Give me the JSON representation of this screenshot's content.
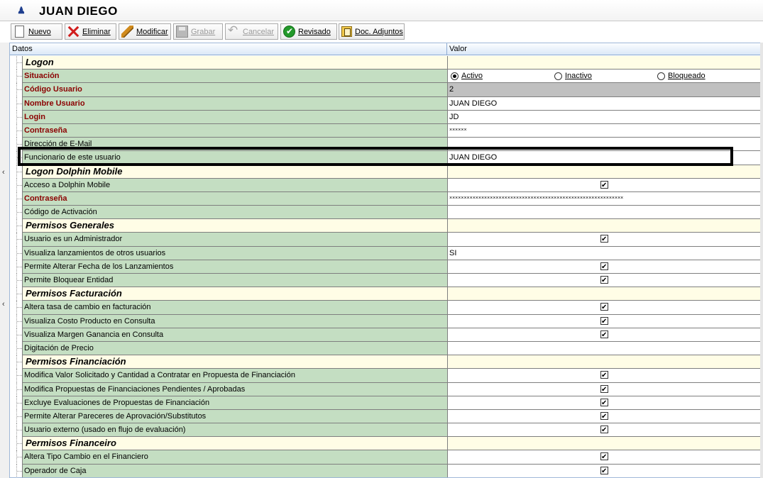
{
  "window": {
    "title": "JUAN DIEGO",
    "app_icon": "user-icon"
  },
  "toolbar": {
    "buttons": [
      {
        "label": "Nuevo",
        "icon": "new-document-icon",
        "enabled": true
      },
      {
        "label": "Eliminar",
        "icon": "delete-x-icon",
        "enabled": true
      },
      {
        "label": "Modificar",
        "icon": "edit-pencil-icon",
        "enabled": true
      },
      {
        "label": "Grabar",
        "icon": "save-disk-icon",
        "enabled": false
      },
      {
        "label": "Cancelar",
        "icon": "undo-icon",
        "enabled": false
      },
      {
        "label": "Revisado",
        "icon": "checkmark-icon",
        "enabled": true
      },
      {
        "label": "Doc. Adjuntos",
        "icon": "attachments-icon",
        "enabled": true
      }
    ]
  },
  "grid": {
    "headers": {
      "datos": "Datos",
      "valor": "Valor"
    },
    "rows": [
      {
        "kind": "section",
        "label": "Logon"
      },
      {
        "kind": "field",
        "required": true,
        "label": "Situación",
        "type": "radio",
        "options": [
          "Activo",
          "Inactivo",
          "Bloqueado"
        ],
        "selected": "Activo"
      },
      {
        "kind": "field",
        "required": true,
        "label": "Código Usuario",
        "type": "text",
        "value": "2",
        "readonly": true
      },
      {
        "kind": "field",
        "required": true,
        "label": "Nombre Usuario",
        "type": "text",
        "value": "JUAN DIEGO"
      },
      {
        "kind": "field",
        "required": true,
        "label": "Login",
        "type": "text",
        "value": "JD"
      },
      {
        "kind": "field",
        "required": true,
        "label": "Contraseña",
        "type": "password",
        "value": "××××××"
      },
      {
        "kind": "field",
        "required": false,
        "label": "Dirección de E-Mail",
        "type": "text",
        "value": ""
      },
      {
        "kind": "field",
        "required": false,
        "label": "Funcionario de este usuario",
        "type": "text",
        "value": "JUAN DIEGO",
        "highlighted": true
      },
      {
        "kind": "section",
        "label": "Logon Dolphin Mobile"
      },
      {
        "kind": "field",
        "required": false,
        "label": "Acceso a Dolphin Mobile",
        "type": "checkbox",
        "checked": true
      },
      {
        "kind": "field",
        "required": true,
        "label": "Contraseña",
        "type": "password",
        "value": "××××××××××××××××××××××××××××××××××××××××××××××××××××××××××××"
      },
      {
        "kind": "field",
        "required": false,
        "label": "Código de Activación",
        "type": "text",
        "value": ""
      },
      {
        "kind": "section",
        "label": "Permisos Generales"
      },
      {
        "kind": "field",
        "required": false,
        "label": "Usuario es un Administrador",
        "type": "checkbox",
        "checked": true
      },
      {
        "kind": "field",
        "required": false,
        "label": "Visualiza lanzamientos de otros usuarios",
        "type": "text",
        "value": "SI"
      },
      {
        "kind": "field",
        "required": false,
        "label": "Permite Alterar Fecha de los Lanzamientos",
        "type": "checkbox",
        "checked": true
      },
      {
        "kind": "field",
        "required": false,
        "label": "Permite Bloquear Entidad",
        "type": "checkbox",
        "checked": true
      },
      {
        "kind": "section",
        "label": "Permisos Facturación"
      },
      {
        "kind": "field",
        "required": false,
        "label": "Altera tasa de cambio en facturación",
        "type": "checkbox",
        "checked": true
      },
      {
        "kind": "field",
        "required": false,
        "label": "Visualiza Costo Producto en Consulta",
        "type": "checkbox",
        "checked": true
      },
      {
        "kind": "field",
        "required": false,
        "label": "Visualiza Margen Ganancia en Consulta",
        "type": "checkbox",
        "checked": true
      },
      {
        "kind": "field",
        "required": false,
        "label": "Digitación de Precio",
        "type": "text",
        "value": ""
      },
      {
        "kind": "section",
        "label": "Permisos Financiación"
      },
      {
        "kind": "field",
        "required": false,
        "label": "Modifica Valor Solicitado y Cantidad a Contratar en Propuesta de Financiación",
        "type": "checkbox",
        "checked": true
      },
      {
        "kind": "field",
        "required": false,
        "label": "Modifica Propuestas de Financiaciones Pendientes / Aprobadas",
        "type": "checkbox",
        "checked": true
      },
      {
        "kind": "field",
        "required": false,
        "label": "Excluye Evaluaciones de Propuestas de Financiación",
        "type": "checkbox",
        "checked": true
      },
      {
        "kind": "field",
        "required": false,
        "label": "Permite Alterar Pareceres de Aprovación/Substitutos",
        "type": "checkbox",
        "checked": true
      },
      {
        "kind": "field",
        "required": false,
        "label": "Usuario externo (usado en flujo de evaluación)",
        "type": "checkbox",
        "checked": true
      },
      {
        "kind": "section",
        "label": "Permisos Financeiro"
      },
      {
        "kind": "field",
        "required": false,
        "label": "Altera Tipo Cambio en el Financiero",
        "type": "checkbox",
        "checked": true
      },
      {
        "kind": "field",
        "required": false,
        "label": "Operador de Caja",
        "type": "checkbox",
        "checked": true
      }
    ]
  }
}
